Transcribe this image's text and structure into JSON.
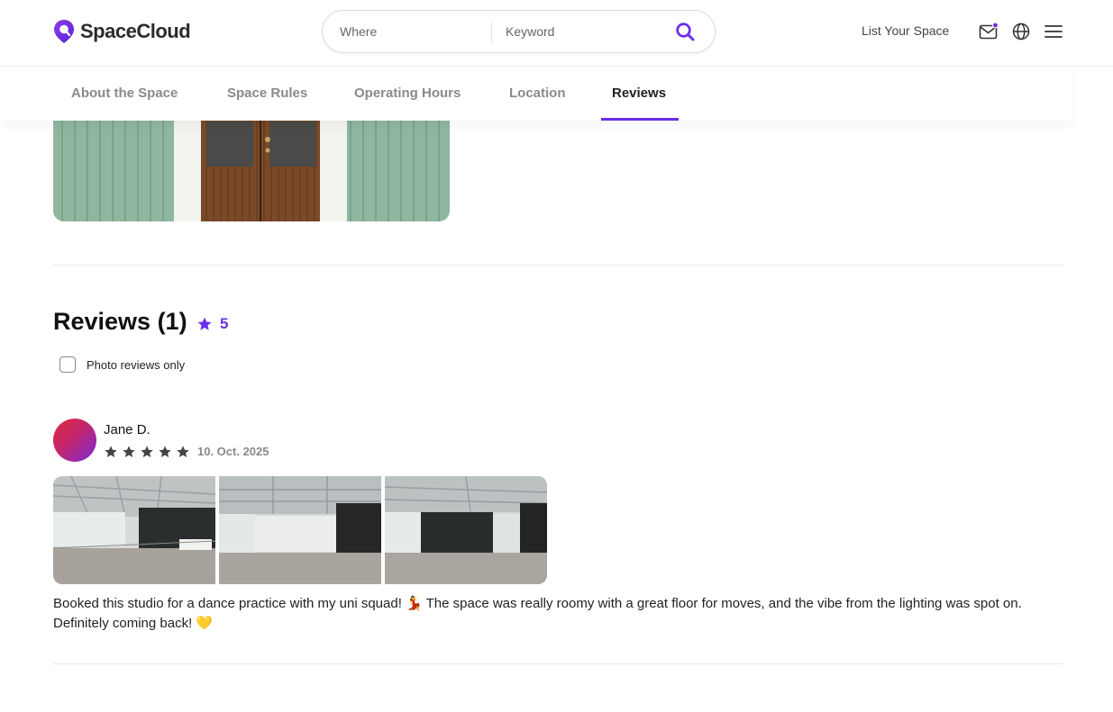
{
  "brand": {
    "name": "SpaceCloud",
    "accent_color": "#6a2ee8"
  },
  "search": {
    "where_placeholder": "Where",
    "keyword_placeholder": "Keyword",
    "button_icon": "search-icon"
  },
  "header": {
    "list_space_label": "List Your Space",
    "icons": [
      "mail-notification-icon",
      "globe-icon",
      "hamburger-menu-icon"
    ]
  },
  "tabs": [
    {
      "label": "About the Space",
      "active": false
    },
    {
      "label": "Space Rules",
      "active": false
    },
    {
      "label": "Operating Hours",
      "active": false
    },
    {
      "label": "Location",
      "active": false
    },
    {
      "label": "Reviews",
      "active": true
    }
  ],
  "reviews": {
    "title": "Reviews (1)",
    "rating": "5",
    "photo_filter_label": "Photo reviews only",
    "photo_filter_checked": false,
    "items": [
      {
        "reviewer": "Jane D.",
        "stars": 5,
        "date": "10. Oct. 2025",
        "photo_count": 3,
        "text": "Booked this studio for a dance practice with my uni squad! 💃 The space was really roomy with a great floor for moves, and the vibe from the lighting was spot on. Definitely coming back! 💛"
      }
    ]
  }
}
